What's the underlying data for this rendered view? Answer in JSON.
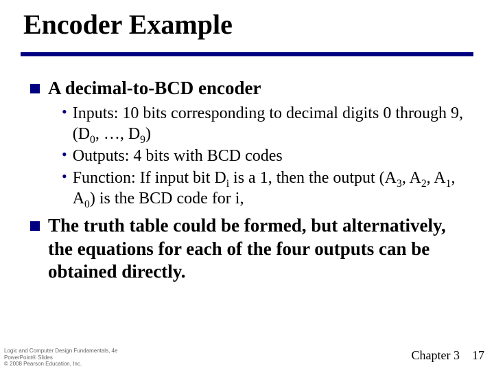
{
  "title": "Encoder Example",
  "bullets": {
    "a": {
      "head": "A decimal-to-BCD encoder",
      "sub1_pre": "Inputs: 10 bits corresponding to decimal digits 0 through 9, (D",
      "sub1_s0": "0",
      "sub1_mid": ", …, D",
      "sub1_s9": "9",
      "sub1_post": ")",
      "sub2": "Outputs: 4 bits with BCD codes",
      "sub3_pre": "Function: If input bit D",
      "sub3_si": "i",
      "sub3_mid": " is a 1, then the output (A",
      "sub3_s3": "3",
      "sub3_c1": ", A",
      "sub3_s2": "2",
      "sub3_c2": ", A",
      "sub3_s1": "1",
      "sub3_c3": ", A",
      "sub3_s0": "0",
      "sub3_post": ") is the BCD code for i,"
    },
    "b": "The truth table could be formed, but alternatively, the equations for each of the four outputs can be obtained directly."
  },
  "footer": {
    "l1": "Logic and Computer Design Fundamentals, 4e",
    "l2": "PowerPoint® Slides",
    "l3": "© 2008 Pearson Education, Inc.",
    "chapter": "Chapter 3",
    "page": "17"
  }
}
